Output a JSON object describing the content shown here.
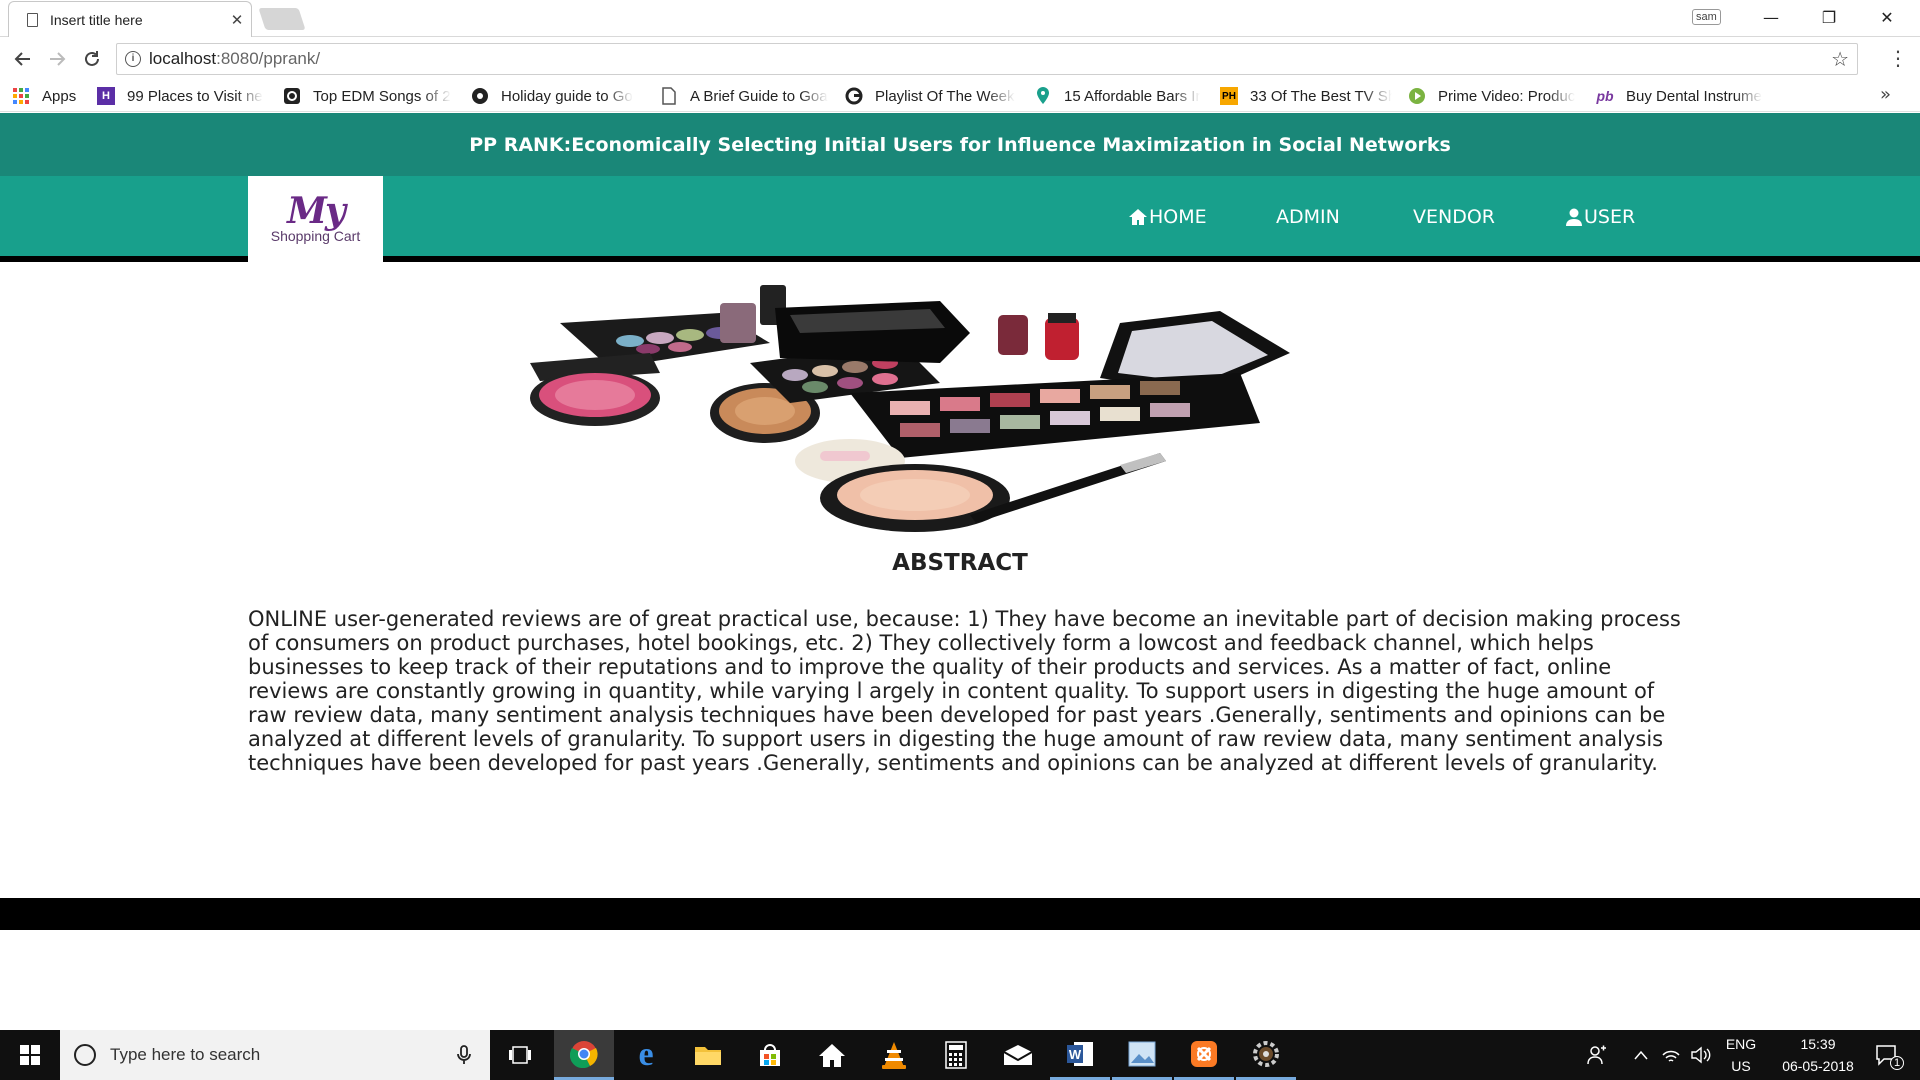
{
  "browser": {
    "tab_title": "Insert title here",
    "tab_close": "✕",
    "profile_label": "sam",
    "window_controls": {
      "minimize": "—",
      "restore": "❐",
      "close": "✕"
    },
    "url_host": "localhost",
    "url_path": ":8080/pprank/",
    "bookmarks": [
      {
        "label": "Apps",
        "icon": "apps-grid-icon"
      },
      {
        "label": "99 Places to Visit ne",
        "icon": "bookmark-h-icon"
      },
      {
        "label": "Top EDM Songs of 2",
        "icon": "music-icon"
      },
      {
        "label": "Holiday guide to Go",
        "icon": "guide-icon"
      },
      {
        "label": "A Brief Guide to Goa",
        "icon": "page-icon"
      },
      {
        "label": "Playlist Of The Week",
        "icon": "g-logo-icon"
      },
      {
        "label": "15 Affordable Bars Ir",
        "icon": "map-pin-icon"
      },
      {
        "label": "33 Of The Best TV Sh",
        "icon": "ph-icon"
      },
      {
        "label": "Prime Video: Produc",
        "icon": "play-icon"
      },
      {
        "label": "Buy Dental Instrume",
        "icon": "pb-icon"
      }
    ],
    "bookmarks_more": "»",
    "bookmark_badges": {
      "ph": "PH",
      "pb": "pb",
      "h": "H"
    }
  },
  "site": {
    "title": "PP RANK:Economically Selecting Initial Users for Influence Maximization in Social Networks",
    "logo_main": "My",
    "logo_sub": "Shopping Cart",
    "nav": {
      "home": "HOME",
      "admin": "ADMIN",
      "vendor": "VENDOR",
      "user": "USER"
    },
    "abstract_heading": "ABSTRACT",
    "abstract_text": "ONLINE user-generated reviews are of great practical use, because: 1) They have become an inevitable part of decision making process of consumers on product purchases, hotel bookings, etc. 2) They collectively form a lowcost and feedback channel, which helps businesses to keep track of their reputations and to improve the quality of their products and services. As a matter of fact, online reviews are constantly growing in quantity, while varying l argely in content quality. To support users in digesting the huge amount of raw review data, many sentiment analysis techniques have been developed for past years .Generally, sentiments and opinions can be analyzed at different levels of granularity. To support users in digesting the huge amount of raw review data, many sentiment analysis techniques have been developed for past years .Generally, sentiments and opinions can be analyzed at different levels of granularity.",
    "colors": {
      "title_bar": "#1a8778",
      "nav_bar": "#18a08c",
      "logo_purple": "#6a2a86"
    }
  },
  "taskbar": {
    "search_placeholder": "Type here to search",
    "apps": [
      "task-view-icon",
      "chrome-icon",
      "edge-icon",
      "file-explorer-icon",
      "store-icon",
      "home-icon",
      "vlc-icon",
      "calculator-icon",
      "mail-icon",
      "word-icon",
      "photos-icon",
      "xampp-icon",
      "settings-icon"
    ],
    "language": "ENG",
    "region": "US",
    "time": "15:39",
    "date": "06-05-2018",
    "notification_count": "1"
  }
}
